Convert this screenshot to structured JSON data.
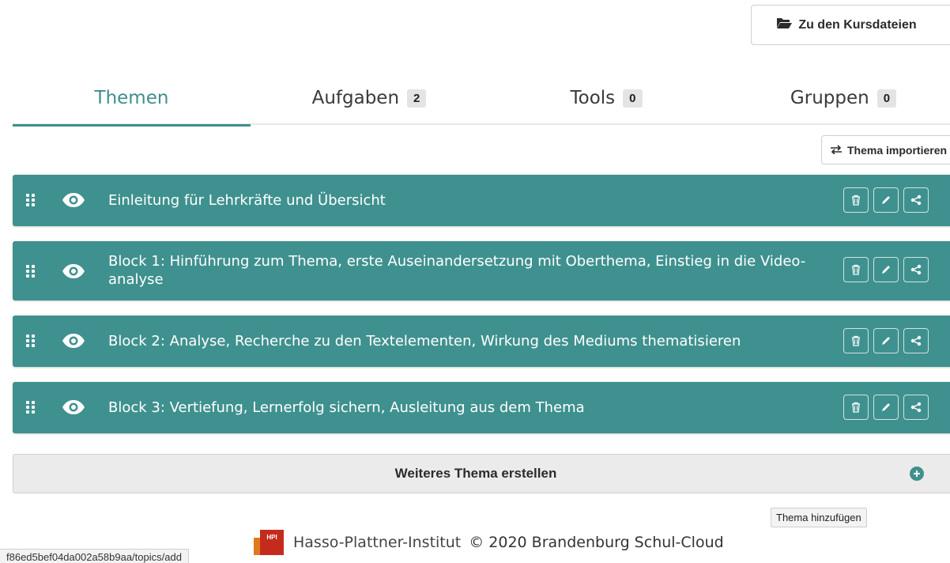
{
  "header": {
    "files_button_label": "Zu den Kursdateien"
  },
  "tabs": [
    {
      "label": "Themen",
      "badge": null,
      "active": true
    },
    {
      "label": "Aufgaben",
      "badge": "2",
      "active": false
    },
    {
      "label": "Tools",
      "badge": "0",
      "active": false
    },
    {
      "label": "Gruppen",
      "badge": "0",
      "active": false
    }
  ],
  "import_button_label": "Thema importieren",
  "topics": [
    {
      "title": "Einleitung für Lehrkräfte und Übersicht"
    },
    {
      "title": "Block 1: Hinführung zum Thema, erste Auseinandersetzung mit Oberthema, Einstieg in die Video-analyse"
    },
    {
      "title": "Block 2: Analyse, Recherche zu den Textelementen, Wirkung des Mediums thematisieren"
    },
    {
      "title": "Block 3: Vertiefung, Lernerfolg sichern, Ausleitung aus dem Thema"
    }
  ],
  "add_topic_label": "Weiteres Thema erstellen",
  "tooltip": "Thema hinzufügen",
  "footer": {
    "logo_text": "HPI",
    "institute": "Hasso-Plattner-Institut",
    "copyright": "© 2020 Brandenburg Schul-Cloud"
  },
  "status_url": "f86ed5bef04da002a58b9aa/topics/add",
  "colors": {
    "accent": "#3f918f",
    "tab_active": "#3f8f8c",
    "logo_red": "#c32c1c"
  }
}
